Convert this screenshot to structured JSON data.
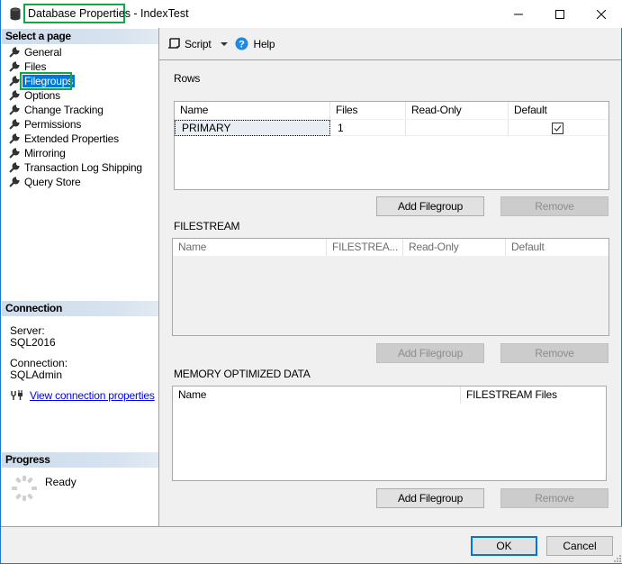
{
  "window": {
    "title_highlighted": "Database Properties",
    "title_rest": " - IndexTest",
    "controls": {
      "minimize": "minimize",
      "maximize": "maximize",
      "close": "close"
    }
  },
  "sidebar": {
    "select_page_header": "Select a page",
    "pages": [
      {
        "label": "General",
        "selected": false
      },
      {
        "label": "Files",
        "selected": false
      },
      {
        "label": "Filegroups",
        "selected": true
      },
      {
        "label": "Options",
        "selected": false
      },
      {
        "label": "Change Tracking",
        "selected": false
      },
      {
        "label": "Permissions",
        "selected": false
      },
      {
        "label": "Extended Properties",
        "selected": false
      },
      {
        "label": "Mirroring",
        "selected": false
      },
      {
        "label": "Transaction Log Shipping",
        "selected": false
      },
      {
        "label": "Query Store",
        "selected": false
      }
    ],
    "connection_header": "Connection",
    "server_label": "Server:",
    "server_value": "SQL2016",
    "connection_label": "Connection:",
    "connection_value": "SQLAdmin",
    "view_connection_link": "View connection properties",
    "progress_header": "Progress",
    "progress_status": "Ready"
  },
  "toolbar": {
    "script_label": "Script",
    "help_label": "Help"
  },
  "rows_section": {
    "label": "Rows",
    "columns": [
      "Name",
      "Files",
      "Read-Only",
      "Default"
    ],
    "rows": [
      {
        "name": "PRIMARY",
        "files": "1",
        "read_only": false,
        "default": true
      }
    ],
    "add_button": "Add Filegroup",
    "remove_button": "Remove"
  },
  "filestream_section": {
    "label": "FILESTREAM",
    "columns": [
      "Name",
      "FILESTREA...",
      "Read-Only",
      "Default"
    ],
    "rows": [],
    "add_button": "Add Filegroup",
    "remove_button": "Remove"
  },
  "memory_section": {
    "label": "MEMORY OPTIMIZED DATA",
    "columns": [
      "Name",
      "FILESTREAM Files"
    ],
    "rows": [],
    "add_button": "Add Filegroup",
    "remove_button": "Remove"
  },
  "footer": {
    "ok_label": "OK",
    "cancel_label": "Cancel"
  },
  "colors": {
    "accent": "#0078d7",
    "highlight_box": "#19a34a",
    "link": "#0000ee"
  }
}
